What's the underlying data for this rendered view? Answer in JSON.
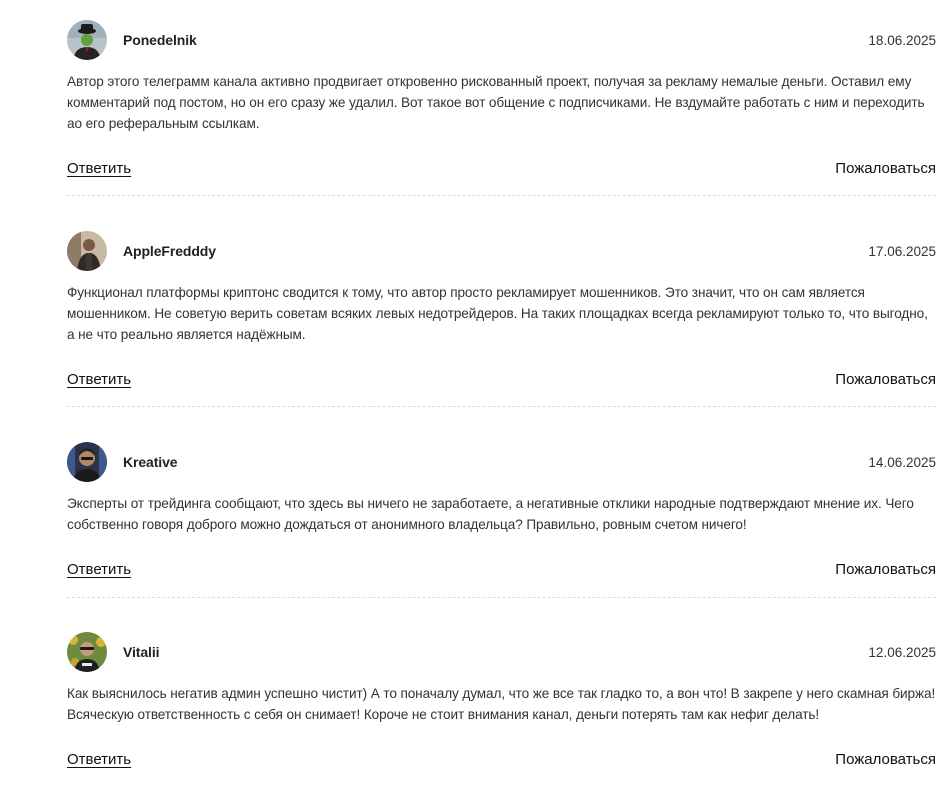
{
  "comments": [
    {
      "author": "Ponedelnik",
      "date": "18.06.2025",
      "text": "Автор этого телеграмм канала активно продвигает откровенно рискованный проект, получая за рекламу немалые деньги. Оставил ему комментарий под постом, но он его сразу же удалил. Вот такое вот общение с подписчиками. Не вздумайте работать с ним и переходить ао его реферальным ссылкам.",
      "reply_label": "Ответить",
      "report_label": "Пожаловаться"
    },
    {
      "author": "AppleFredddy",
      "date": "17.06.2025",
      "text": "Функционал платформы криптонс сводится к тому, что автор просто рекламирует мошенников. Это значит, что он сам является мошенником. Не советую верить советам всяких левых недотрейдеров. На таких площадках всегда рекламируют только то, что выгодно, а не что реально является надёжным.",
      "reply_label": "Ответить",
      "report_label": "Пожаловаться"
    },
    {
      "author": "Kreative",
      "date": "14.06.2025",
      "text": "Эксперты от трейдинга сообщают, что здесь вы ничего не заработаете, а негативные отклики народные подтверждают мнение их. Чего собственно говоря доброго можно дождаться от анонимного владельца? Правильно, ровным счетом ничего!",
      "reply_label": "Ответить",
      "report_label": "Пожаловаться"
    },
    {
      "author": "Vitalii",
      "date": "12.06.2025",
      "text": "Как выяснилось негатив админ успешно чистит) А то поначалу думал, что же все так гладко то, а вон что! В закрепе у него скамная биржа! Всяческую ответственность с себя он снимает! Короче не стоит внимания канал, деньги потерять там как нефиг делать!",
      "reply_label": "Ответить",
      "report_label": "Пожаловаться"
    }
  ]
}
